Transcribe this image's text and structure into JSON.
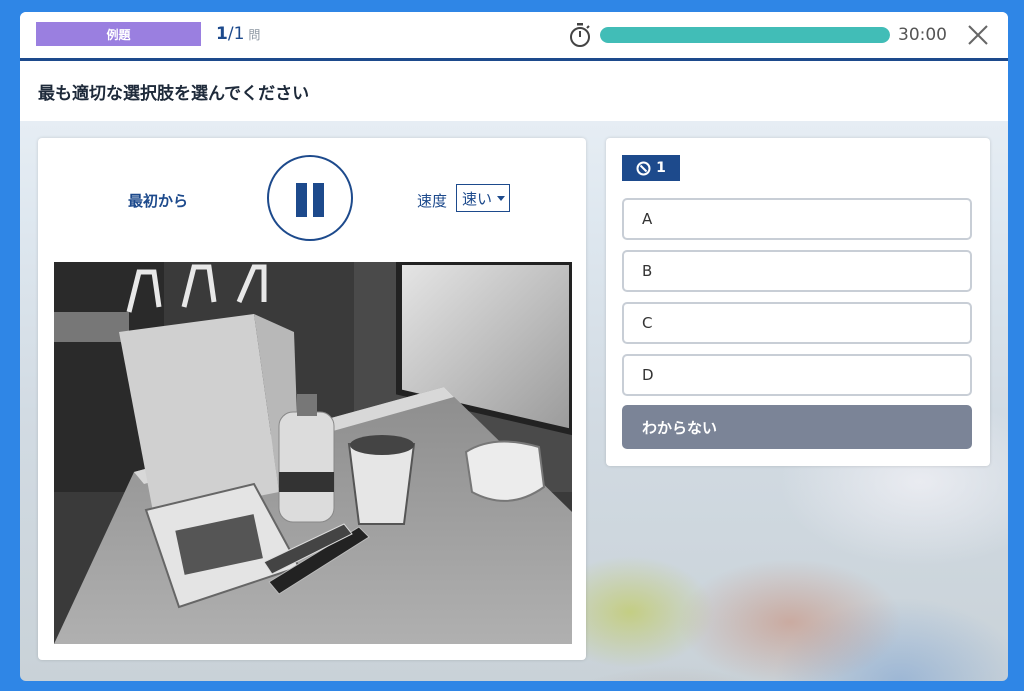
{
  "header": {
    "badge": "例題",
    "counter_current": "1",
    "counter_total": "/1",
    "counter_unit": "問",
    "timer": "30:00",
    "progress_fraction": 1.0
  },
  "instruction": "最も適切な選択肢を選んでください",
  "player": {
    "restart_label": "最初から",
    "speed_label": "速度",
    "speed_value": "速い"
  },
  "question": {
    "number": "1",
    "options": [
      "A",
      "B",
      "C",
      "D"
    ],
    "unknown_label": "わからない"
  },
  "colors": {
    "brand_navy": "#1d4a8c",
    "badge_purple": "#9a7fe0",
    "progress_teal": "#41bdb7",
    "unknown_gray": "#7b8497",
    "frame_blue": "#2f86e6"
  },
  "icons": {
    "timer": "stopwatch-icon",
    "close": "close-icon",
    "pause": "pause-icon",
    "question": "search-icon"
  }
}
